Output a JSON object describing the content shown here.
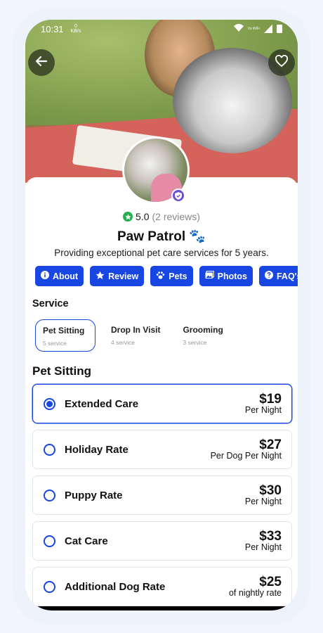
{
  "status_bar": {
    "time": "10:31",
    "speed_value": "0",
    "speed_unit": "KB/s",
    "network": "Vo WiFi"
  },
  "profile": {
    "rating": "5.0",
    "reviews": "(2 reviews)",
    "name": "Paw Patrol 🐾",
    "description": "Providing exceptional pet care services for 5 years."
  },
  "chips": [
    {
      "label": "About",
      "icon": "info-icon"
    },
    {
      "label": "Review",
      "icon": "star-icon"
    },
    {
      "label": "Pets",
      "icon": "paw-icon"
    },
    {
      "label": "Photos",
      "icon": "photo-icon"
    },
    {
      "label": "FAQ's",
      "icon": "question-icon"
    }
  ],
  "service": {
    "title": "Service",
    "tabs": [
      {
        "label": "Pet Sitting",
        "count": "5 service",
        "active": true
      },
      {
        "label": "Drop In Visit",
        "count": "4 service",
        "active": false
      },
      {
        "label": "Grooming",
        "count": "3 service",
        "active": false
      }
    ]
  },
  "pet_sitting": {
    "title": "Pet Sitting",
    "options": [
      {
        "name": "Extended Care",
        "price": "$19",
        "unit": "Per Night",
        "selected": true
      },
      {
        "name": "Holiday Rate",
        "price": "$27",
        "unit": "Per Dog Per Night",
        "selected": false
      },
      {
        "name": "Puppy Rate",
        "price": "$30",
        "unit": "Per Night",
        "selected": false
      },
      {
        "name": "Cat Care",
        "price": "$33",
        "unit": "Per Night",
        "selected": false
      },
      {
        "name": "Additional Dog Rate",
        "price": "$25",
        "unit": "of nightly rate",
        "selected": false
      }
    ]
  },
  "colors": {
    "accent": "#1746e2",
    "rating_green": "#22b14c",
    "verified_purple": "#6b4bd8"
  }
}
